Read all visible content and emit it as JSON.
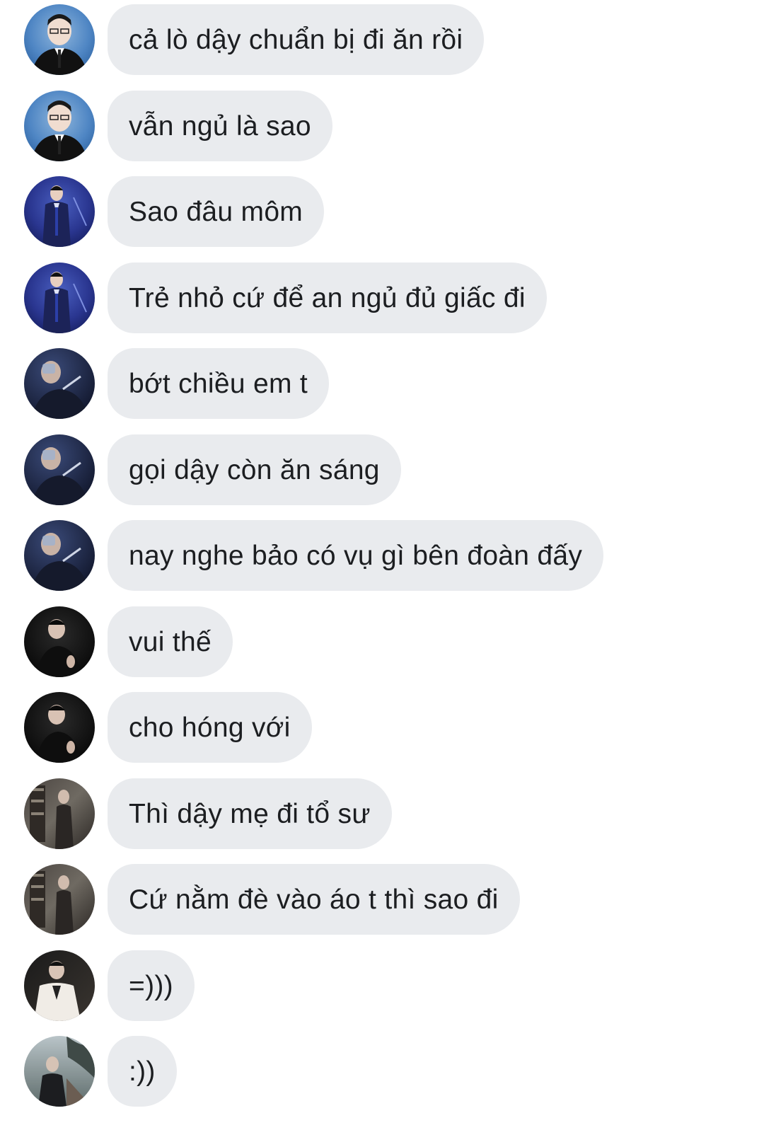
{
  "conversation": {
    "messages": [
      {
        "text": "cả lò dậy chuẩn bị đi ăn rồi",
        "avatar": "avatar-blue-suit-photo"
      },
      {
        "text": "vẫn ngủ là sao",
        "avatar": "avatar-blue-suit-photo"
      },
      {
        "text": "Sao đâu môm",
        "avatar": "avatar-stage-navy-photo"
      },
      {
        "text": "Trẻ nhỏ cứ để an ngủ đủ giấc đi",
        "avatar": "avatar-stage-navy-photo"
      },
      {
        "text": "bớt chiều em t",
        "avatar": "avatar-dark-drinking-photo"
      },
      {
        "text": "gọi dậy còn ăn sáng",
        "avatar": "avatar-dark-drinking-photo"
      },
      {
        "text": "nay nghe bảo có vụ gì bên đoàn đấy",
        "avatar": "avatar-dark-drinking-photo"
      },
      {
        "text": "vui thế",
        "avatar": "avatar-black-portrait-photo"
      },
      {
        "text": "cho hóng với",
        "avatar": "avatar-black-portrait-photo"
      },
      {
        "text": "Thì dậy mẹ đi tổ sư",
        "avatar": "avatar-bookshelf-photo"
      },
      {
        "text": "Cứ nằm đè vào áo t thì sao đi",
        "avatar": "avatar-bookshelf-photo"
      },
      {
        "text": "=)))",
        "avatar": "avatar-white-coat-photo"
      },
      {
        "text": ":))",
        "avatar": "avatar-outdoor-tree-photo"
      }
    ]
  },
  "colors": {
    "bubble": "#e9ebee",
    "text": "#1c1e21",
    "background": "#ffffff"
  }
}
